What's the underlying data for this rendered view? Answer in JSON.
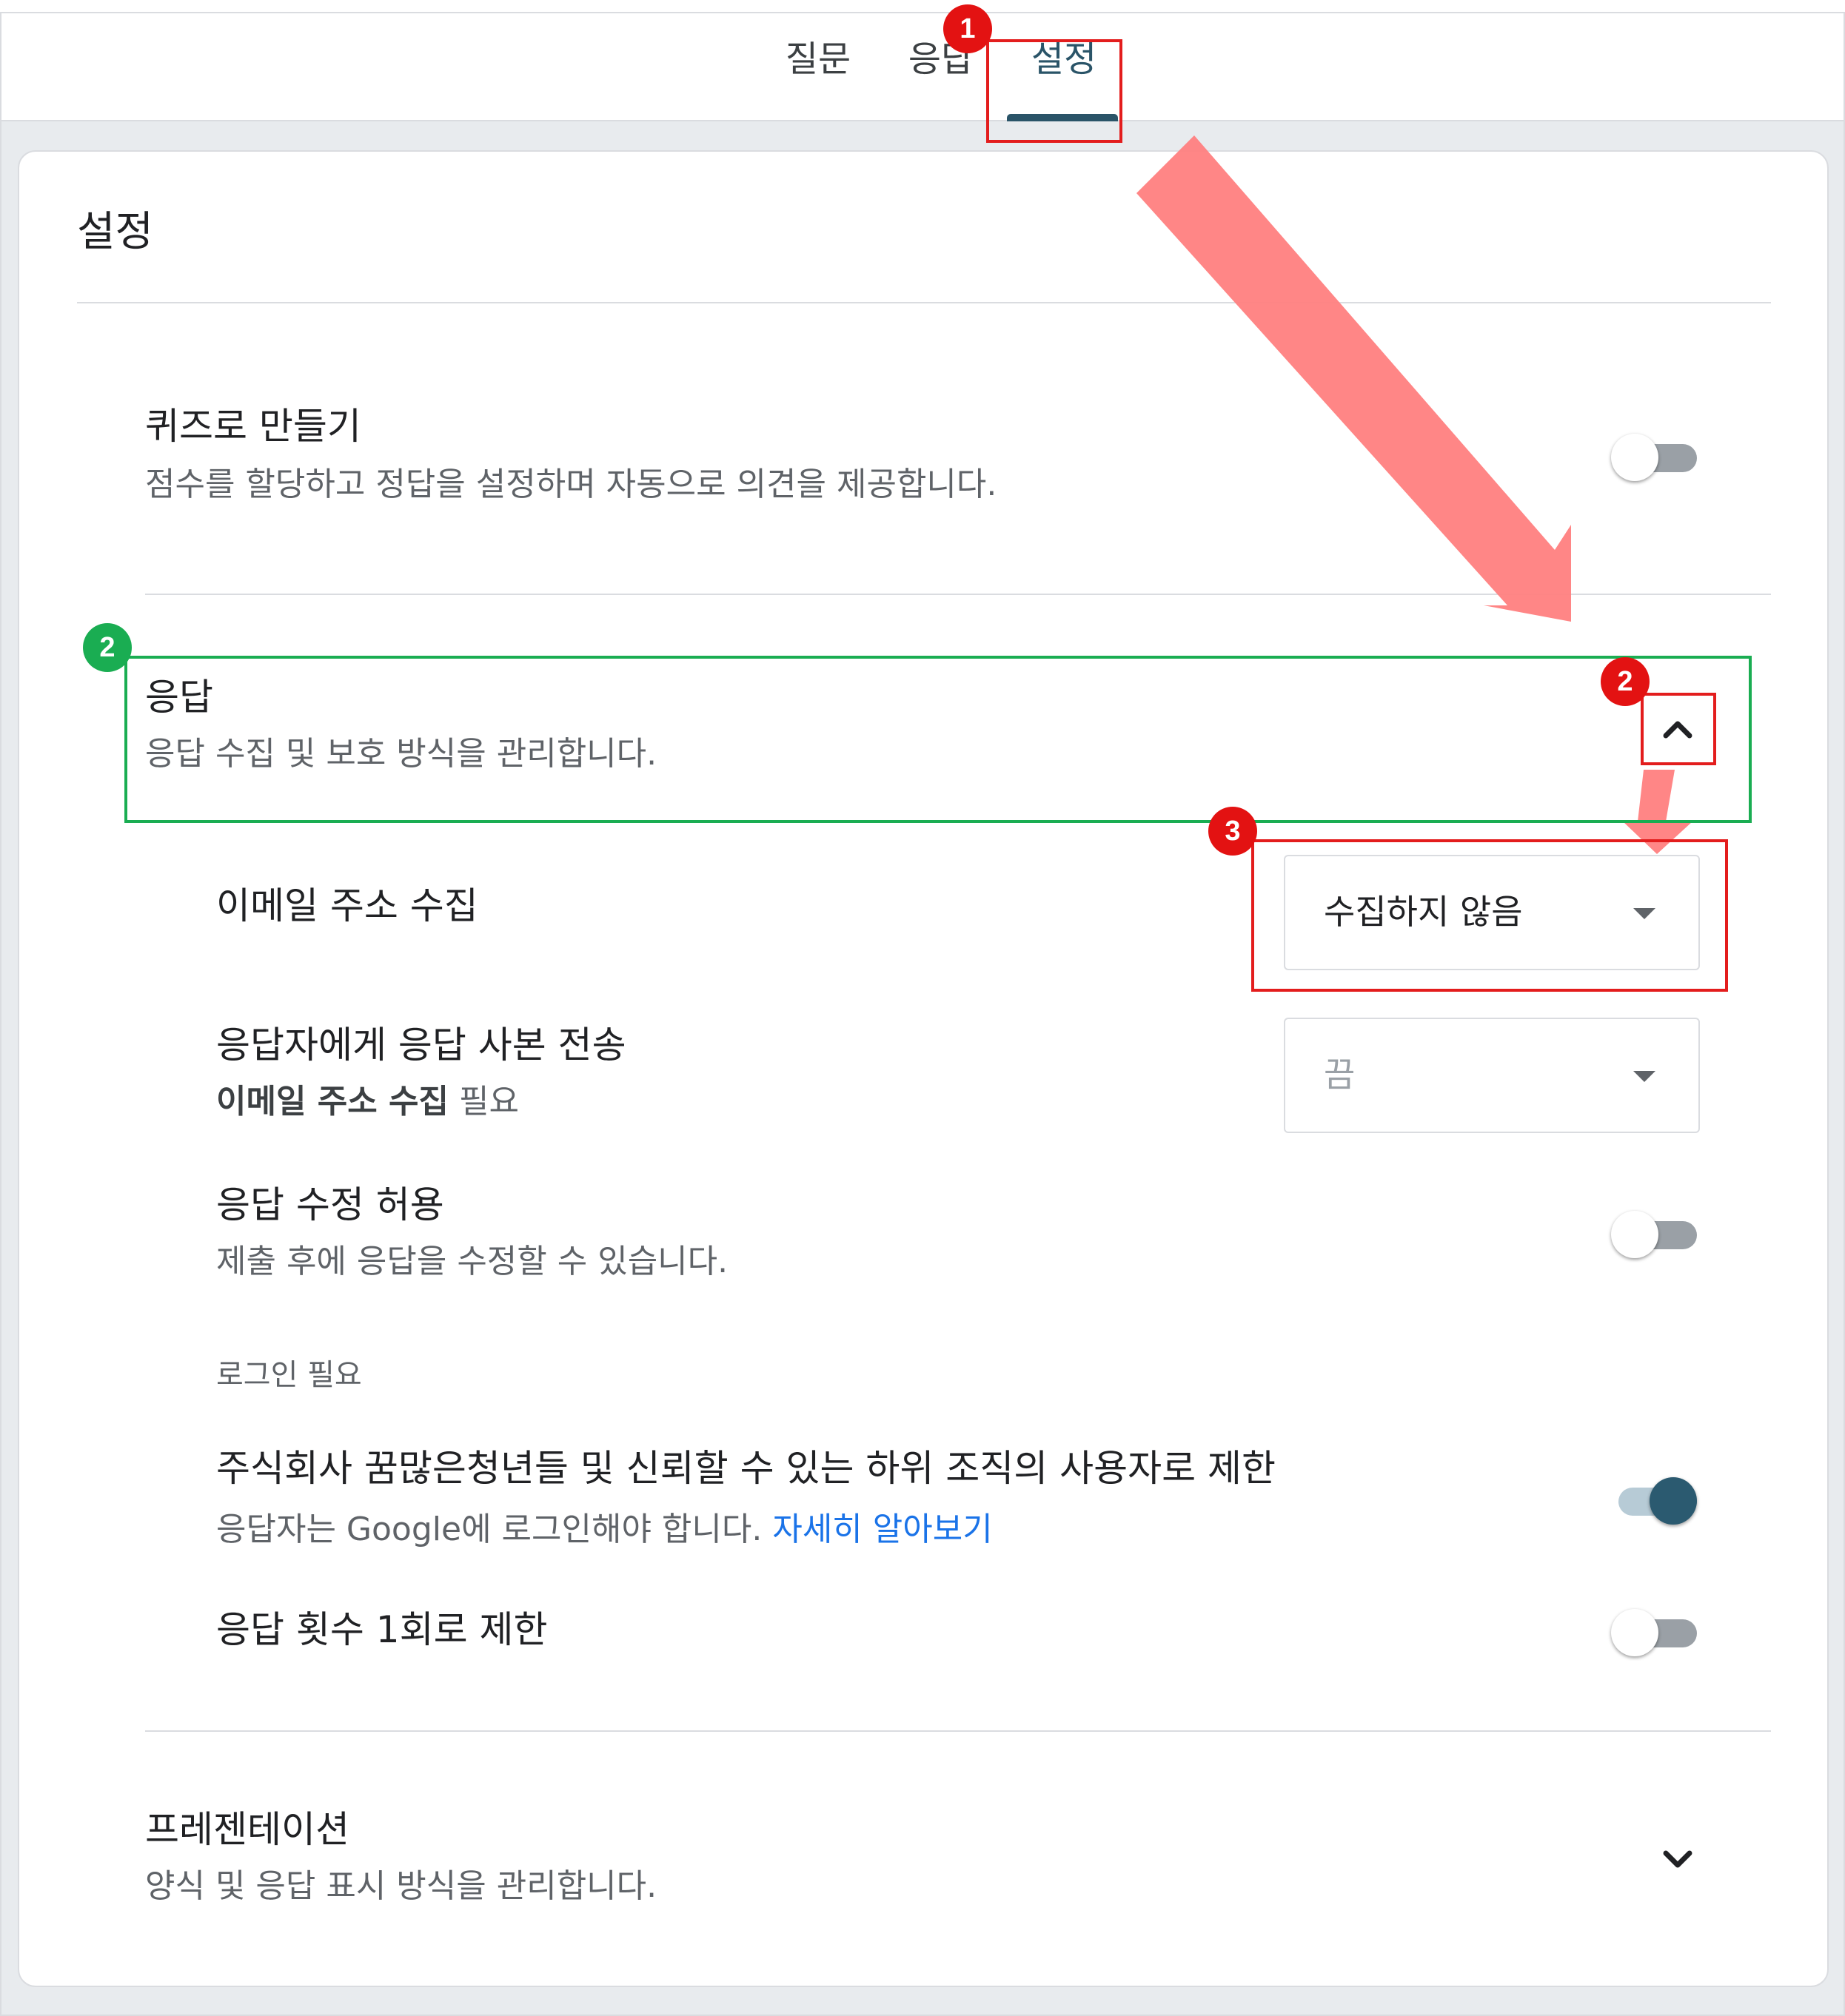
{
  "tabs": [
    {
      "label": "질문",
      "active": false
    },
    {
      "label": "응답",
      "active": false
    },
    {
      "label": "설정",
      "active": true
    }
  ],
  "settings": {
    "heading": "설정",
    "quiz": {
      "title": "퀴즈로 만들기",
      "description": "점수를 할당하고 정답을 설정하며 자동으로 의견을 제공합니다.",
      "toggle_on": false
    },
    "responses": {
      "title": "응답",
      "description": "응답 수집 및 보호 방식을 관리합니다.",
      "expanded": true,
      "collect_email": {
        "label": "이메일 주소 수집",
        "value": "수집하지 않음"
      },
      "send_copy": {
        "label": "응답자에게 응답 사본 전송",
        "hint_bold": "이메일 주소 수집",
        "hint_rest": " 필요",
        "value": "끔",
        "disabled": true
      },
      "allow_edit": {
        "label": "응답 수정 허용",
        "description": "제출 후에 응답을 수정할 수 있습니다.",
        "toggle_on": false
      },
      "login_required": {
        "section_label": "로그인 필요",
        "restrict_org": {
          "label": "주식회사 꿈많은청년들 및 신뢰할 수 있는 하위 조직의 사용자로 제한",
          "description": "응답자는 Google에 로그인해야 합니다. ",
          "link": "자세히 알아보기",
          "toggle_on": true
        },
        "limit_one": {
          "label": "응답 횟수 1회로 제한",
          "toggle_on": false
        }
      }
    },
    "presentation": {
      "title": "프레젠테이션",
      "description": "양식 및 응답 표시 방식을 관리합니다.",
      "expanded": false
    }
  },
  "annotations": {
    "badge_1": "1",
    "badge_2_green": "2",
    "badge_2_red": "2",
    "badge_3": "3",
    "highlight_red": "#e31d1d",
    "highlight_green": "#1aad52",
    "arrow_color": "#ff7f7f"
  },
  "colors": {
    "accent": "#2a5468",
    "toggle_on": "#2b5a70",
    "link": "#1a73e8"
  }
}
